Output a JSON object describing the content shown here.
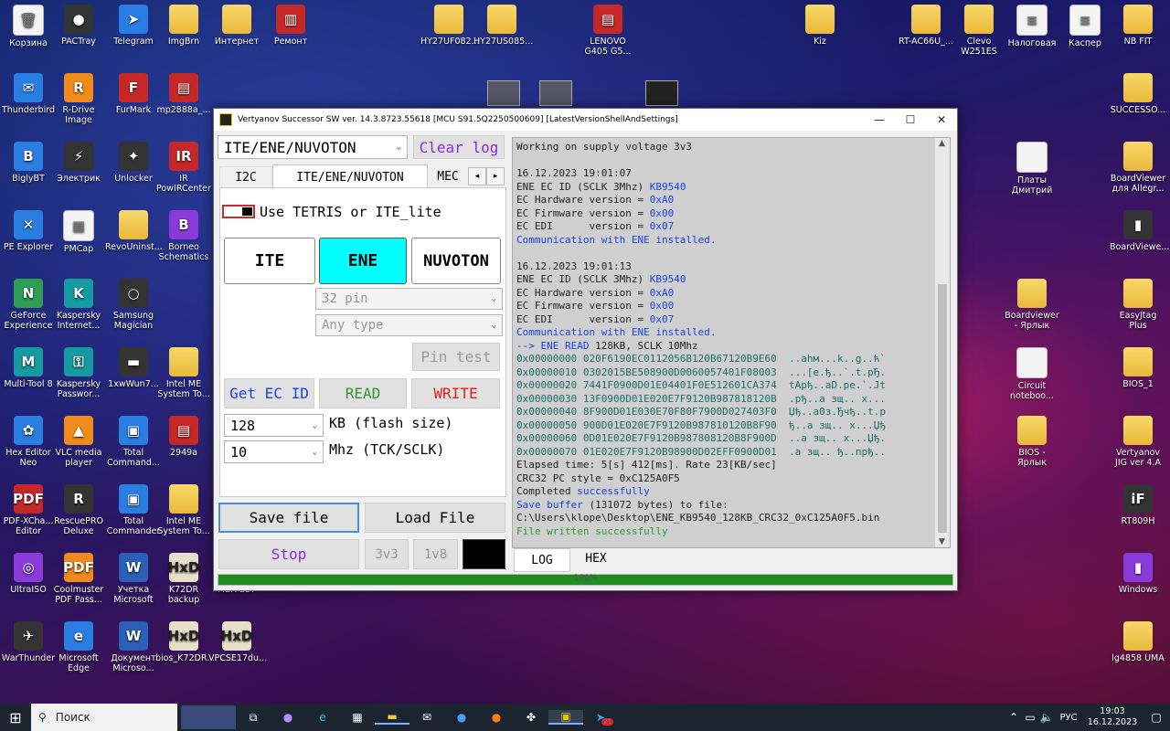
{
  "desktop_icons": [
    {
      "label": "Корзина",
      "style": "doc",
      "glyph": "🗑"
    },
    {
      "label": "PACTray",
      "style": "dark",
      "glyph": "●"
    },
    {
      "label": "Telegram",
      "style": "blue",
      "glyph": "➤"
    },
    {
      "label": "ImgBrn",
      "style": "folder",
      "glyph": ""
    },
    {
      "label": "Интернет",
      "style": "folder",
      "glyph": ""
    },
    {
      "label": "Ремонт",
      "style": "red",
      "glyph": "▥"
    },
    {
      "label": "HY27UF082...",
      "style": "folder",
      "glyph": ""
    },
    {
      "label": "HY27US085...",
      "style": "folder",
      "glyph": ""
    },
    {
      "label": "LENOVO G405 G5...",
      "style": "red",
      "glyph": "▤"
    },
    {
      "label": "Kiz",
      "style": "folder",
      "glyph": ""
    },
    {
      "label": "RT-AC66U_...",
      "style": "folder",
      "glyph": ""
    },
    {
      "label": "Clevo W251ES",
      "style": "folder",
      "glyph": ""
    },
    {
      "label": "Налоговая",
      "style": "doc",
      "glyph": "≡"
    },
    {
      "label": "Каспер",
      "style": "doc",
      "glyph": "≡"
    },
    {
      "label": "NB FIT",
      "style": "folder",
      "glyph": ""
    },
    {
      "label": "Thunderbird",
      "style": "blue",
      "glyph": "✉"
    },
    {
      "label": "R-Drive Image",
      "style": "orange",
      "glyph": "R"
    },
    {
      "label": "FurMark",
      "style": "red",
      "glyph": "F"
    },
    {
      "label": "mp2888a_...",
      "style": "red",
      "glyph": "▤"
    },
    {
      "label": "SUCCESSO...",
      "style": "folder",
      "glyph": ""
    },
    {
      "label": "BiglyBT",
      "style": "blue",
      "glyph": "B"
    },
    {
      "label": "Электрик",
      "style": "dark",
      "glyph": "⚡"
    },
    {
      "label": "Unlocker",
      "style": "dark",
      "glyph": "✦"
    },
    {
      "label": "IR PowIRCenter",
      "style": "red",
      "glyph": "IR"
    },
    {
      "label": "Платы Дмитрий",
      "style": "doc",
      "glyph": ""
    },
    {
      "label": "BoardViewer для Allegr...",
      "style": "folder",
      "glyph": ""
    },
    {
      "label": "PE Explorer",
      "style": "blue",
      "glyph": "✕"
    },
    {
      "label": "PMCap",
      "style": "doc",
      "glyph": "▦"
    },
    {
      "label": "RevoUninst...",
      "style": "folder",
      "glyph": ""
    },
    {
      "label": "Borneo Schematics",
      "style": "purple",
      "glyph": "B"
    },
    {
      "label": "BoardViewe...",
      "style": "dark",
      "glyph": "▮"
    },
    {
      "label": "GeForce Experience",
      "style": "green",
      "glyph": "N"
    },
    {
      "label": "Kaspersky Internet...",
      "style": "teal",
      "glyph": "K"
    },
    {
      "label": "Samsung Magician",
      "style": "dark",
      "glyph": "○"
    },
    {
      "label": "Boardviewer - Ярлык",
      "style": "folder",
      "glyph": ""
    },
    {
      "label": "EasyJtag Plus",
      "style": "folder",
      "glyph": ""
    },
    {
      "label": "Multi-Tool 8",
      "style": "teal",
      "glyph": "M"
    },
    {
      "label": "Kaspersky Passwor...",
      "style": "teal",
      "glyph": "⚿"
    },
    {
      "label": "1xwWun7...",
      "style": "dark",
      "glyph": "▬"
    },
    {
      "label": "Intel ME System To...",
      "style": "folder",
      "glyph": ""
    },
    {
      "label": "Circuit noteboo...",
      "style": "doc",
      "glyph": ""
    },
    {
      "label": "BIOS_1",
      "style": "folder",
      "glyph": ""
    },
    {
      "label": "Hex Editor Neo",
      "style": "blue",
      "glyph": "✿"
    },
    {
      "label": "VLC media player",
      "style": "orange",
      "glyph": "▲"
    },
    {
      "label": "Total Command...",
      "style": "blue",
      "glyph": "▣"
    },
    {
      "label": "2949a",
      "style": "red",
      "glyph": "▤"
    },
    {
      "label": "BIOS - Ярлык",
      "style": "folder",
      "glyph": ""
    },
    {
      "label": "Vertyanov JIG ver 4.A",
      "style": "folder",
      "glyph": ""
    },
    {
      "label": "PDF-XCha... Editor",
      "style": "red",
      "glyph": "PDF"
    },
    {
      "label": "RescuePRO Deluxe",
      "style": "dark",
      "glyph": "R"
    },
    {
      "label": "Total Commander",
      "style": "blue",
      "glyph": "▣"
    },
    {
      "label": "Intel ME System To...",
      "style": "folder",
      "glyph": ""
    },
    {
      "label": "RT809H",
      "style": "dark",
      "glyph": "iF"
    },
    {
      "label": "UltraISO",
      "style": "purple",
      "glyph": "◎"
    },
    {
      "label": "Coolmuster PDF Pass...",
      "style": "orange",
      "glyph": "PDF"
    },
    {
      "label": "Учетка Microsoft",
      "style": "word",
      "glyph": "W"
    },
    {
      "label": "K72DR backup",
      "style": "hxd",
      "glyph": "HxD"
    },
    {
      "label": "MBX-237",
      "style": "folder",
      "glyph": ""
    },
    {
      "label": "Windows",
      "style": "purple",
      "glyph": "▮"
    },
    {
      "label": "WarThunder",
      "style": "dark",
      "glyph": "✈"
    },
    {
      "label": "Microsoft Edge",
      "style": "blue",
      "glyph": "e"
    },
    {
      "label": "Документ Microso...",
      "style": "word",
      "glyph": "W"
    },
    {
      "label": "bios_K72DR...",
      "style": "hxd",
      "glyph": "HxD"
    },
    {
      "label": "VPCSE17du...",
      "style": "hxd",
      "glyph": "HxD"
    },
    {
      "label": "lg4858 UMA",
      "style": "folder",
      "glyph": ""
    }
  ],
  "window": {
    "title": "Vertyanov Successor SW ver. 14.3.8723.55618 [MCU S91.5Q2250500609] [LatestVersionShellAndSettings]",
    "minimize": "—",
    "maximize": "☐",
    "close": "✕"
  },
  "controls": {
    "mode_select": "ITE/ENE/NUVOTON",
    "clear_log": "Clear log",
    "tabs": [
      "I2C",
      "ITE/ENE/NUVOTON",
      "MEC"
    ],
    "tab_prev": "◂",
    "tab_next": "▸",
    "use_tetris_label": "Use TETRIS or ITE_lite",
    "chip_buttons": [
      "ITE",
      "ENE",
      "NUVOTON"
    ],
    "pin_select": "32 pin",
    "type_select": "Any type",
    "pin_test": "Pin test",
    "get_ec_id": "Get EC ID",
    "read": "READ",
    "write": "WRITE",
    "flash_size_value": "128",
    "flash_size_label": "KB (flash size)",
    "freq_value": "10",
    "freq_label": "Mhz (TCK/SCLK)",
    "save_file": "Save file",
    "load_file": "Load File",
    "stop": "Stop",
    "v33": "3v3",
    "v18": "1v8",
    "progress_percent": 100,
    "progress_text": "100%"
  },
  "log_tabs": [
    "LOG",
    "HEX"
  ],
  "log_lines": [
    {
      "text": "Working on supply voltage 3v3",
      "color": ""
    },
    {
      "text": "",
      "color": ""
    },
    {
      "text": "16.12.2023 19:01:07",
      "color": ""
    },
    {
      "text": "ENE EC ID (SCLK 3Mhz) ",
      "color": "",
      "tail": "KB9540",
      "tailcolor": "c-blue"
    },
    {
      "text": "EC Hardware version = ",
      "color": "",
      "tail": "0xA0",
      "tailcolor": "c-blue"
    },
    {
      "text": "EC Firmware version = ",
      "color": "",
      "tail": "0x00",
      "tailcolor": "c-blue"
    },
    {
      "text": "EC EDI      version = ",
      "color": "",
      "tail": "0x07",
      "tailcolor": "c-blue"
    },
    {
      "text": "Communication with ENE installed.",
      "color": "c-blue"
    },
    {
      "text": "",
      "color": ""
    },
    {
      "text": "16.12.2023 19:01:13",
      "color": ""
    },
    {
      "text": "ENE EC ID (SCLK 3Mhz) ",
      "color": "",
      "tail": "KB9540",
      "tailcolor": "c-blue"
    },
    {
      "text": "EC Hardware version = ",
      "color": "",
      "tail": "0xA0",
      "tailcolor": "c-blue"
    },
    {
      "text": "EC Firmware version = ",
      "color": "",
      "tail": "0x00",
      "tailcolor": "c-blue"
    },
    {
      "text": "EC EDI      version = ",
      "color": "",
      "tail": "0x07",
      "tailcolor": "c-blue"
    },
    {
      "text": "Communication with ENE installed.",
      "color": "c-blue"
    },
    {
      "text": "--> ENE READ ",
      "color": "c-blue",
      "tail": "128KB, SCLK 10Mhz",
      "tailcolor": ""
    },
    {
      "text": "0x00000000 020F6190EC0112056B120B67120B9E60  ..аһм...k..g..ћ`",
      "color": "c-teal"
    },
    {
      "text": "0x00000010 0302015BE508900D0060057401F08003  ...[е.ђ..`.t.рЂ.",
      "color": "c-teal"
    },
    {
      "text": "0x00000020 7441F0900D01E04401F0E512601CA374  tAрђ..аD.ре.`.Јt",
      "color": "c-teal"
    },
    {
      "text": "0x00000030 13F0900D01E020E7F9120B987818120B  .рђ..а зщ.. x...",
      "color": "c-teal"
    },
    {
      "text": "0x00000040 8F900D01E030E70F80F7900D027403F0  Џђ..а0з.Ђчђ..t.р",
      "color": "c-teal"
    },
    {
      "text": "0x00000050 900D01E020E7F9120B987810120B8F90  ђ..а зщ.. x...Џђ",
      "color": "c-teal"
    },
    {
      "text": "0x00000060 0D01E020E7F9120B987808120B8F900D  ..а зщ.. x...Џђ.",
      "color": "c-teal"
    },
    {
      "text": "0x00000070 01E020E7F9120B98900D02EFF0900D01  .а зщ.. ђ..прђ..",
      "color": "c-teal"
    },
    {
      "text": "Elapsed time: 5[s] 412[ms]. Rate 23[KB/sec]",
      "color": ""
    },
    {
      "text": "CRC32 PC style = 0xC125A0F5",
      "color": ""
    },
    {
      "text": "Completed ",
      "color": "",
      "tail": "successfully",
      "tailcolor": "c-blue"
    },
    {
      "text": "Save buffer ",
      "color": "c-blue",
      "tail": "(131072 bytes) to file:",
      "tailcolor": ""
    },
    {
      "text": "C:\\Users\\klope\\Desktop\\ENE_KB9540_128KB_CRC32_0xC125A0F5.bin",
      "color": ""
    },
    {
      "text": "File written successfully",
      "color": "c-green"
    }
  ],
  "taskbar": {
    "search_placeholder": "Поиск",
    "lang": "РУС",
    "time": "19:03",
    "date": "16.12.2023",
    "telegram_badge": "21"
  },
  "colors": {
    "ene_active": "#00ffff",
    "clear_log_text": "#8a2be2",
    "read_text": "#2e9a2e",
    "write_text": "#e02020",
    "get_ec_id_text": "#1a44e0",
    "progress": "#1e8c1e"
  }
}
